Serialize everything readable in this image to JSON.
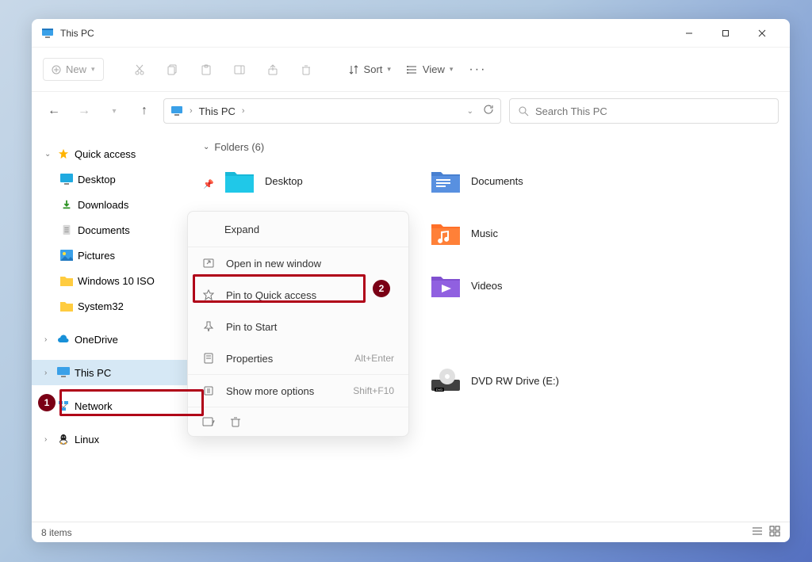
{
  "window": {
    "title": "This PC"
  },
  "toolbar": {
    "new_label": "New",
    "sort_label": "Sort",
    "view_label": "View"
  },
  "address": {
    "location": "This PC"
  },
  "search": {
    "placeholder": "Search This PC"
  },
  "sidebar": {
    "quick_access": "Quick access",
    "items": [
      {
        "label": "Desktop"
      },
      {
        "label": "Downloads"
      },
      {
        "label": "Documents"
      },
      {
        "label": "Pictures"
      },
      {
        "label": "Windows 10 ISO"
      },
      {
        "label": "System32"
      }
    ],
    "onedrive": "OneDrive",
    "this_pc": "This PC",
    "network": "Network",
    "linux": "Linux"
  },
  "content": {
    "section": "Folders (6)",
    "col1": [
      {
        "label": "Desktop"
      }
    ],
    "col2": [
      {
        "label": "Documents"
      },
      {
        "label": "Music"
      },
      {
        "label": "Videos"
      },
      {
        "label": "DVD RW Drive (E:)"
      }
    ]
  },
  "context_menu": {
    "expand": "Expand",
    "open_new_window": "Open in new window",
    "pin_quick_access": "Pin to Quick access",
    "pin_start": "Pin to Start",
    "properties": "Properties",
    "properties_shortcut": "Alt+Enter",
    "show_more": "Show more options",
    "show_more_shortcut": "Shift+F10"
  },
  "statusbar": {
    "items": "8 items"
  },
  "annotations": {
    "badge1": "1",
    "badge2": "2"
  }
}
